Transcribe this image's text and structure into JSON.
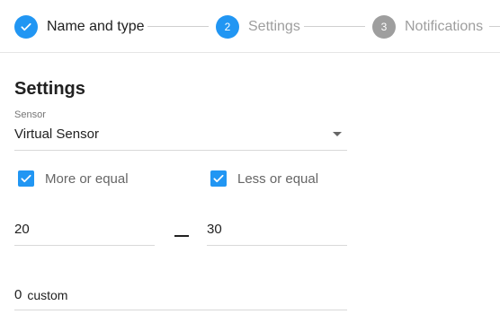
{
  "stepper": {
    "steps": [
      {
        "label": "Name and type",
        "status": "done",
        "number": ""
      },
      {
        "label": "Settings",
        "status": "active",
        "number": "2"
      },
      {
        "label": "Notifications",
        "status": "pending",
        "number": "3"
      }
    ]
  },
  "settings": {
    "title": "Settings",
    "sensor": {
      "label": "Sensor",
      "value": "Virtual Sensor"
    },
    "more_or_equal": {
      "label": "More or equal",
      "checked": true
    },
    "less_or_equal": {
      "label": "Less or equal",
      "checked": true
    },
    "min_value": "20",
    "range_dash": "—",
    "max_value": "30",
    "custom": {
      "value": "0",
      "unit": "custom"
    }
  },
  "colors": {
    "accent": "#2196f3",
    "inactive": "#9e9e9e"
  }
}
